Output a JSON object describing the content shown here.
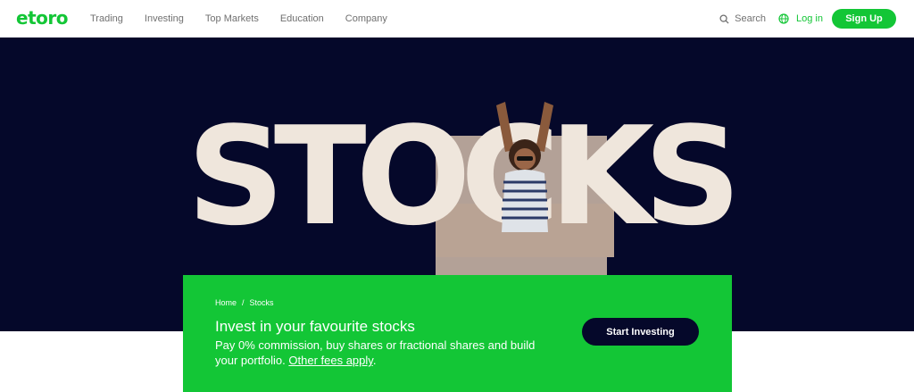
{
  "header": {
    "logo_text": "etoro",
    "nav": [
      "Trading",
      "Investing",
      "Top Markets",
      "Education",
      "Company"
    ],
    "search_label": "Search",
    "login_label": "Log in",
    "signup_label": "Sign Up"
  },
  "hero": {
    "word": "STOCKS"
  },
  "panel": {
    "breadcrumb": [
      "Home",
      "Stocks"
    ],
    "breadcrumb_separator": "/",
    "title": "Invest in your favourite stocks",
    "description": "Pay 0% commission, buy shares or fractional shares and build your portfolio.",
    "fees_link": "Other fees apply",
    "fees_suffix": ".",
    "cta_label": "Start Investing"
  },
  "colors": {
    "brand_green": "#13c636",
    "hero_bg": "#05082a",
    "nav_text": "#707070"
  }
}
